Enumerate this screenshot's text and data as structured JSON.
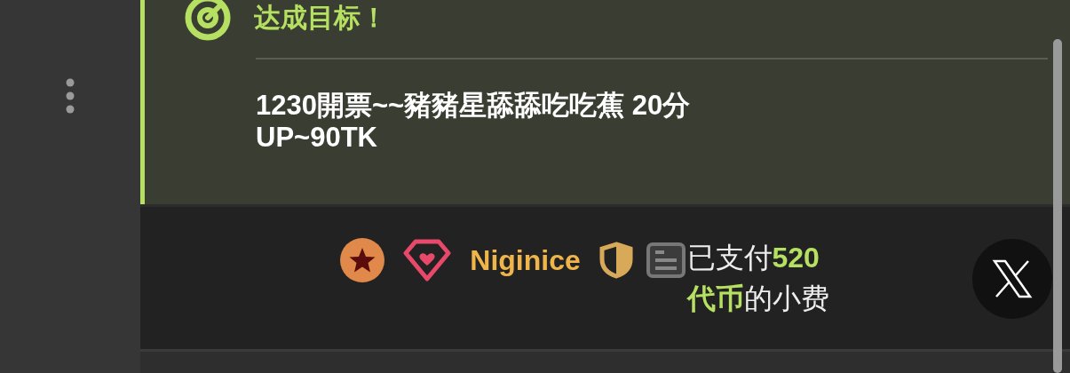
{
  "goal": {
    "title": "达成目标！",
    "description": "1230開票~~豬豬星舔舔吃吃蕉 20分 UP~90TK"
  },
  "tip": {
    "username": "Niginice",
    "message": "已支付**520代币**的小费"
  }
}
